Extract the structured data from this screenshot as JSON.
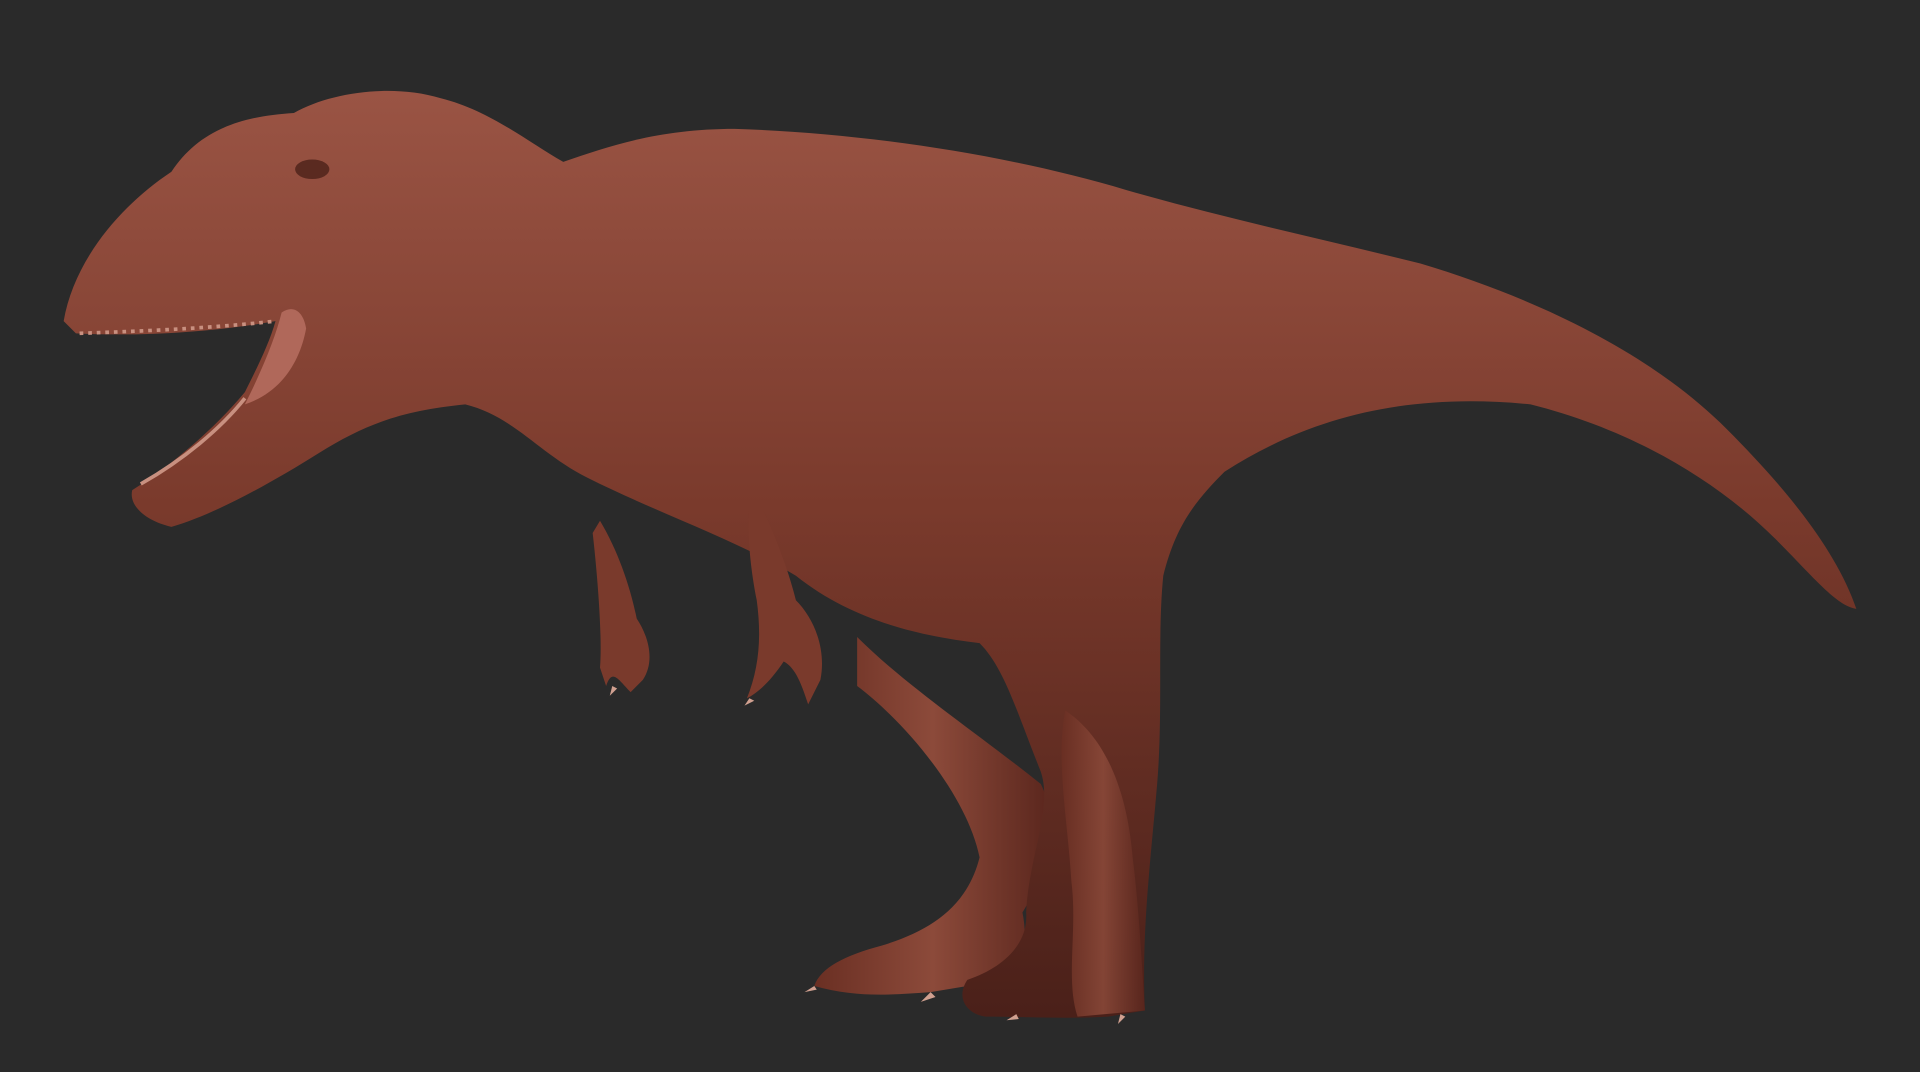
{
  "scene": {
    "subject": "dinosaur-sculpt",
    "colors": {
      "background": "#2a2a2a",
      "skin": "#7a3a2c",
      "skin_highlight": "#9a5444",
      "skin_shadow": "#4a2019",
      "mouth": "#b0685a"
    }
  }
}
